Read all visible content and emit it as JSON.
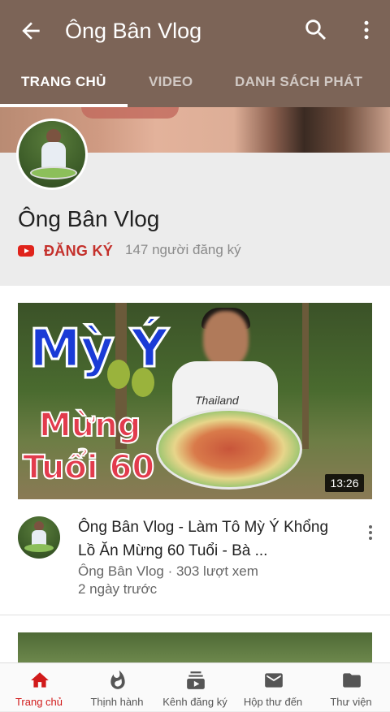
{
  "header": {
    "title": "Ông Bân Vlog"
  },
  "tabs": [
    {
      "label": "TRANG CHỦ",
      "active": true
    },
    {
      "label": "VIDEO",
      "active": false
    },
    {
      "label": "DANH SÁCH PHÁT",
      "active": false
    }
  ],
  "channel": {
    "name": "Ông Bân Vlog",
    "subscribe_label": "ĐĂNG KÝ",
    "subscriber_count": "147 người đăng ký"
  },
  "video": {
    "thumbnail_text": {
      "line1": "Mỳ Ý",
      "line2": "Mừng",
      "line3": "Tuổi 60",
      "shirt": "Thailand"
    },
    "duration": "13:26",
    "title": "Ông Bân Vlog - Làm Tô Mỳ Ý Khổng Lồ Ăn Mừng 60 Tuổi - Bà ...",
    "meta": "Ông Bân Vlog · 303 lượt xem",
    "age": "2 ngày trước"
  },
  "bottom_nav": [
    {
      "label": "Trang chủ",
      "icon": "home-icon",
      "active": true
    },
    {
      "label": "Thịnh hành",
      "icon": "flame-icon",
      "active": false
    },
    {
      "label": "Kênh đăng ký",
      "icon": "subscriptions-icon",
      "active": false
    },
    {
      "label": "Hộp thư đến",
      "icon": "inbox-icon",
      "active": false
    },
    {
      "label": "Thư viện",
      "icon": "folder-icon",
      "active": false
    }
  ],
  "colors": {
    "brand": "#7c6457",
    "accent_red": "#d11a1a",
    "subscribe_red": "#c4302b"
  }
}
